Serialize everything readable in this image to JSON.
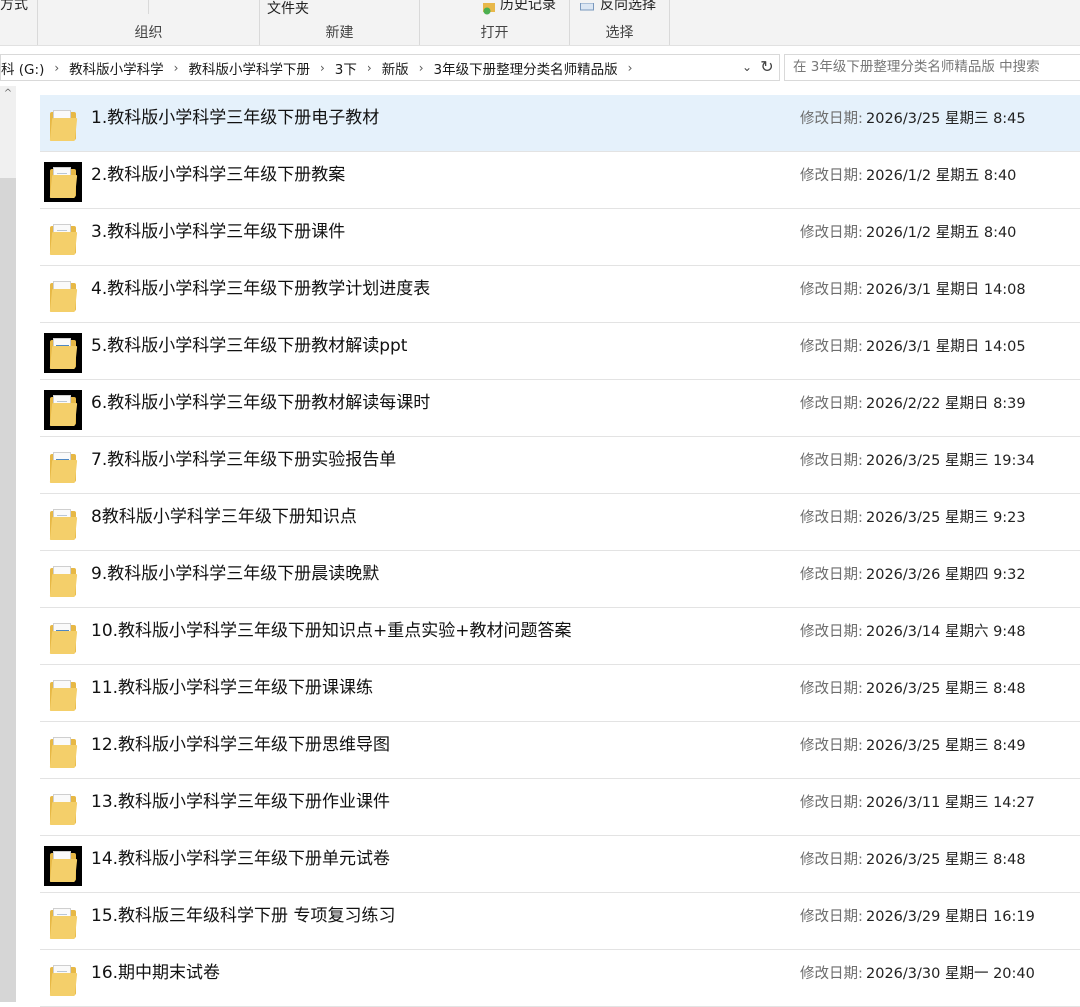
{
  "ribbon": {
    "partial_left": "方式",
    "new_folder": "文件夹",
    "history": "历史记录",
    "invert_select": "反向选择",
    "groups": [
      "组织",
      "新建",
      "打开",
      "选择"
    ]
  },
  "address": {
    "crumbs": [
      "科 (G:)",
      "教科版小学科学",
      "教科版小学科学下册",
      "3下",
      "新版",
      "3年级下册整理分类名师精品版"
    ]
  },
  "search": {
    "placeholder": "在 3年级下册整理分类名师精品版 中搜索"
  },
  "modified_label": "修改日期:",
  "files": [
    {
      "name": "1.教科版小学科学三年级下册电子教材",
      "date": "2026/3/25 星期三 8:45",
      "icon": "folder-pdf-icon",
      "dark": false
    },
    {
      "name": "2.教科版小学科学三年级下册教案",
      "date": "2026/1/2 星期五 8:40",
      "icon": "folder-doc-icon",
      "dark": true
    },
    {
      "name": "3.教科版小学科学三年级下册课件",
      "date": "2026/1/2 星期五 8:40",
      "icon": "folder-doc-icon",
      "dark": false
    },
    {
      "name": "4.教科版小学科学三年级下册教学计划进度表",
      "date": "2026/3/1 星期日 14:08",
      "icon": "folder-icon",
      "dark": false
    },
    {
      "name": "5.教科版小学科学三年级下册教材解读ppt",
      "date": "2026/3/1 星期日 14:05",
      "icon": "folder-image-icon",
      "dark": true
    },
    {
      "name": "6.教科版小学科学三年级下册教材解读每课时",
      "date": "2026/2/22 星期日 8:39",
      "icon": "folder-doc-icon",
      "dark": true
    },
    {
      "name": "7.教科版小学科学三年级下册实验报告单",
      "date": "2026/3/25 星期三 19:34",
      "icon": "folder-image-icon",
      "dark": false
    },
    {
      "name": "8教科版小学科学三年级下册知识点",
      "date": "2026/3/25 星期三 9:23",
      "icon": "folder-doc-icon",
      "dark": false
    },
    {
      "name": "9.教科版小学科学三年级下册晨读晚默",
      "date": "2026/3/26 星期四 9:32",
      "icon": "folder-pdf-icon",
      "dark": false
    },
    {
      "name": "10.教科版小学科学三年级下册知识点+重点实验+教材问题答案",
      "date": "2026/3/14 星期六 9:48",
      "icon": "folder-image-icon",
      "dark": false
    },
    {
      "name": "11.教科版小学科学三年级下册课课练",
      "date": "2026/3/25 星期三 8:48",
      "icon": "folder-icon",
      "dark": false
    },
    {
      "name": "12.教科版小学科学三年级下册思维导图",
      "date": "2026/3/25 星期三 8:49",
      "icon": "folder-pdf-icon",
      "dark": false
    },
    {
      "name": "13.教科版小学科学三年级下册作业课件",
      "date": "2026/3/11 星期三 14:27",
      "icon": "folder-icon",
      "dark": false
    },
    {
      "name": "14.教科版小学科学三年级下册单元试卷",
      "date": "2026/3/25 星期三 8:48",
      "icon": "folder-icon",
      "dark": true
    },
    {
      "name": "15.教科版三年级科学下册 专项复习练习",
      "date": "2026/3/29 星期日 16:19",
      "icon": "folder-doc-icon",
      "dark": false
    },
    {
      "name": "16.期中期末试卷",
      "date": "2026/3/30 星期一 20:40",
      "icon": "folder-doc-icon",
      "dark": false
    }
  ]
}
